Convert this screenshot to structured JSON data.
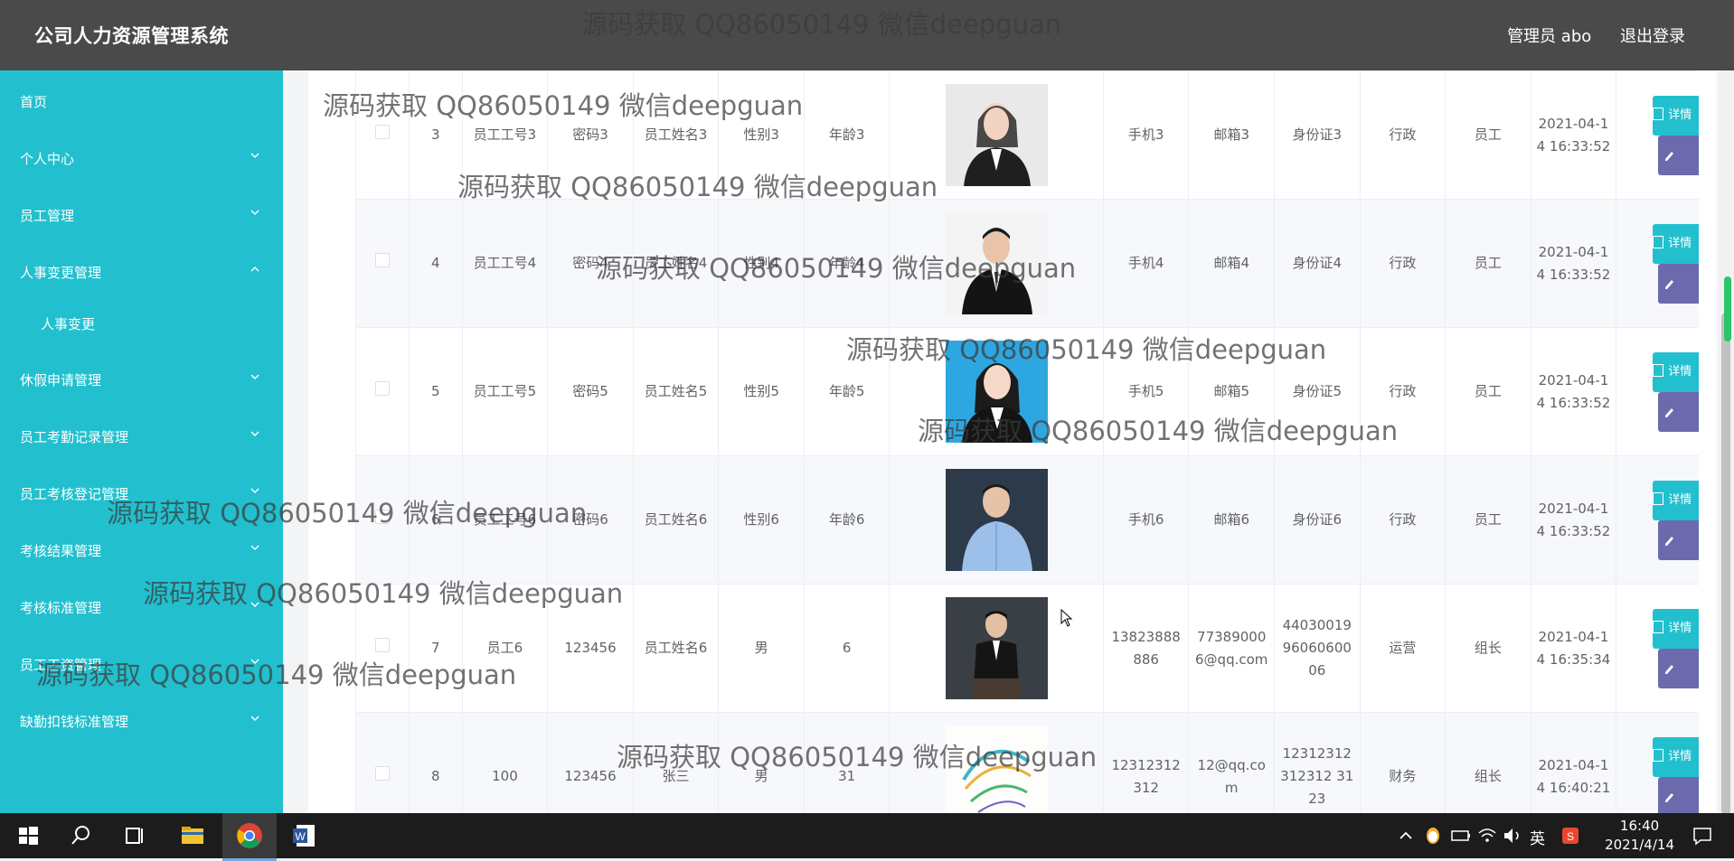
{
  "header": {
    "title": "公司人力资源管理系统",
    "user": "管理员 abo",
    "logout": "退出登录"
  },
  "sidebar": {
    "items": [
      {
        "label": "首页",
        "chevron": ""
      },
      {
        "label": "个人中心",
        "chevron": "down"
      },
      {
        "label": "员工管理",
        "chevron": "down"
      },
      {
        "label": "人事变更管理",
        "chevron": "up"
      },
      {
        "label": "人事变更",
        "chevron": "",
        "sub": true
      },
      {
        "label": "休假申请管理",
        "chevron": "down"
      },
      {
        "label": "员工考勤记录管理",
        "chevron": "down"
      },
      {
        "label": "员工考核登记管理",
        "chevron": "down"
      },
      {
        "label": "考核结果管理",
        "chevron": "down"
      },
      {
        "label": "考核标准管理",
        "chevron": "down"
      },
      {
        "label": "员工工资管理",
        "chevron": "down"
      },
      {
        "label": "缺勤扣钱标准管理",
        "chevron": "down"
      }
    ]
  },
  "table": {
    "detail_label": "详情",
    "rows": [
      {
        "id": "3",
        "emp_no": "员工工号3",
        "password": "密码3",
        "name": "员工姓名3",
        "gender": "性别3",
        "age": "年龄3",
        "photo": "woman-suit",
        "phone": "手机3",
        "email": "邮箱3",
        "id_card": "身份证3",
        "dept": "行政",
        "position": "员工",
        "time": "2021-04-14 16:33:52"
      },
      {
        "id": "4",
        "emp_no": "员工工号4",
        "password": "密码4",
        "name": "员工姓名4",
        "gender": "性别4",
        "age": "年龄4",
        "photo": "man-suit",
        "phone": "手机4",
        "email": "邮箱4",
        "id_card": "身份证4",
        "dept": "行政",
        "position": "员工",
        "time": "2021-04-14 16:33:52"
      },
      {
        "id": "5",
        "emp_no": "员工工号5",
        "password": "密码5",
        "name": "员工姓名5",
        "gender": "性别5",
        "age": "年龄5",
        "photo": "woman-blue",
        "phone": "手机5",
        "email": "邮箱5",
        "id_card": "身份证5",
        "dept": "行政",
        "position": "员工",
        "time": "2021-04-14 16:33:52"
      },
      {
        "id": "6",
        "emp_no": "员工工号6",
        "password": "密码6",
        "name": "员工姓名6",
        "gender": "性别6",
        "age": "年龄6",
        "photo": "man-shirt",
        "phone": "手机6",
        "email": "邮箱6",
        "id_card": "身份证6",
        "dept": "行政",
        "position": "员工",
        "time": "2021-04-14 16:33:52"
      },
      {
        "id": "7",
        "emp_no": "员工6",
        "password": "123456",
        "name": "员工姓名6",
        "gender": "男",
        "age": "6",
        "photo": "man-dark",
        "phone": "13823888886",
        "email": "773890006@qq.com",
        "id_card": "440300199606060006",
        "dept": "运营",
        "position": "组长",
        "time": "2021-04-14 16:35:34"
      },
      {
        "id": "8",
        "emp_no": "100",
        "password": "123456",
        "name": "张三",
        "gender": "男",
        "age": "31",
        "photo": "logo",
        "phone": "12312312312",
        "email": "12@qq.com",
        "id_card": "12312312312312 3123",
        "dept": "财务",
        "position": "组长",
        "time": "2021-04-14 16:40:21"
      }
    ]
  },
  "watermark": "源码获取 QQ86050149 微信deepguan",
  "taskbar": {
    "time": "16:40",
    "date": "2021/4/14",
    "ime": "英"
  },
  "colors": {
    "sidebar": "#22c0cf",
    "header": "#4a4a4a",
    "detail_button": "#22c0cf",
    "edit_button": "#6c6aad"
  }
}
